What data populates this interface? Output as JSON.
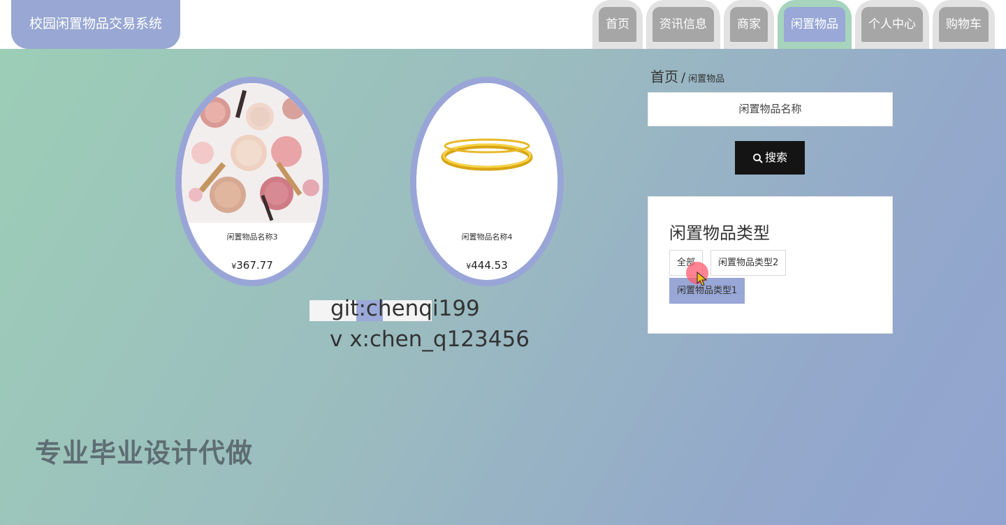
{
  "header": {
    "brand": "校园闲置物品交易系统",
    "nav": [
      {
        "label": "首页",
        "active": false
      },
      {
        "label": "资讯信息",
        "active": false
      },
      {
        "label": "商家",
        "active": false
      },
      {
        "label": "闲置物品",
        "active": true
      },
      {
        "label": "个人中心",
        "active": false
      },
      {
        "label": "购物车",
        "active": false
      }
    ]
  },
  "products": [
    {
      "name": "闲置物品名称3",
      "currency": "¥",
      "price": "367.77",
      "image": "cosmetics-image"
    },
    {
      "name": "闲置物品名称4",
      "currency": "¥",
      "price": "444.53",
      "image": "gold-bangle-image"
    }
  ],
  "watermark": {
    "git": "git:chenqi199",
    "vx": "v x:chen_q123456",
    "promo": "专业毕业设计代做"
  },
  "breadcrumb": {
    "home": "首页",
    "separator": "/",
    "current": "闲置物品"
  },
  "search": {
    "placeholder": "闲置物品名称",
    "button_label": "搜索",
    "button_icon": "search-icon"
  },
  "categories": {
    "title": "闲置物品类型",
    "items": [
      {
        "label": "全部",
        "selected": false
      },
      {
        "label": "闲置物品类型2",
        "selected": false
      },
      {
        "label": "闲置物品类型1",
        "selected": true
      }
    ]
  },
  "colors": {
    "accent": "#98a7d5",
    "nav_active_ring": "#a6d4bc",
    "search_button": "#141414",
    "background_start": "#9ccfb6",
    "background_end": "#91a4d0"
  }
}
